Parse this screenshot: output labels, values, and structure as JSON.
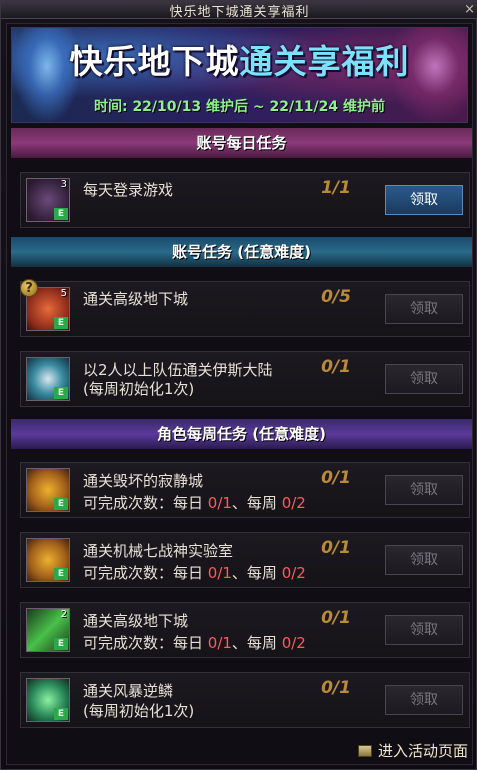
{
  "window": {
    "title": "快乐地下城通关享福利",
    "close_glyph": "×"
  },
  "banner": {
    "headline_part1": "快乐地下城",
    "headline_part2": "通关享福利",
    "subline": "时间: 22/10/13 维护后 ~ 22/11/24 维护前"
  },
  "sections": {
    "daily": "账号每日任务",
    "account": "账号任务 (任意难度)",
    "weekly": "角色每周任务 (任意难度)"
  },
  "tasks": [
    {
      "name": "每天登录游戏",
      "sub": "",
      "progress": "1/1",
      "button": "领取",
      "icon": "chest-icon",
      "icon_qty": "3",
      "badge": "E",
      "button_state": "active"
    },
    {
      "name": "通关高级地下城",
      "sub": "",
      "progress": "0/5",
      "button": "领取",
      "icon": "red-chest-icon",
      "icon_qty": "5",
      "badge": "E",
      "button_state": "disabled"
    },
    {
      "name": "以2人以上队伍通关伊斯大陆",
      "sub": "(每周初始化1次)",
      "progress": "0/1",
      "button": "领取",
      "icon": "teal-emblem-icon",
      "icon_qty": "",
      "badge": "E",
      "button_state": "disabled"
    },
    {
      "name": "通关毁坏的寂静城",
      "sub_prefix": "可完成次数：每日 ",
      "daily": "0/1",
      "sub_mid": "、每周 ",
      "weekly": "0/2",
      "progress": "0/1",
      "button": "领取",
      "icon": "gold-orb-icon",
      "icon_qty": "",
      "badge": "E",
      "button_state": "disabled"
    },
    {
      "name": "通关机械七战神实验室",
      "sub_prefix": "可完成次数：每日 ",
      "daily": "0/1",
      "sub_mid": "、每周 ",
      "weekly": "0/2",
      "progress": "0/1",
      "button": "领取",
      "icon": "gold-orb-icon",
      "icon_qty": "",
      "badge": "E",
      "button_state": "disabled"
    },
    {
      "name": "通关高级地下城",
      "sub_prefix": "可完成次数：每日 ",
      "daily": "0/1",
      "sub_mid": "、每周 ",
      "weekly": "0/2",
      "progress": "0/1",
      "button": "领取",
      "icon": "sword-icon",
      "icon_qty": "2",
      "badge": "E",
      "button_state": "disabled"
    },
    {
      "name": "通关风暴逆鳞",
      "sub": "(每周初始化1次)",
      "progress": "0/1",
      "button": "领取",
      "icon": "green-crystal-icon",
      "icon_qty": "",
      "badge": "E",
      "button_state": "disabled"
    }
  ],
  "help_glyph": "?",
  "footer": {
    "link": "进入活动页面"
  }
}
